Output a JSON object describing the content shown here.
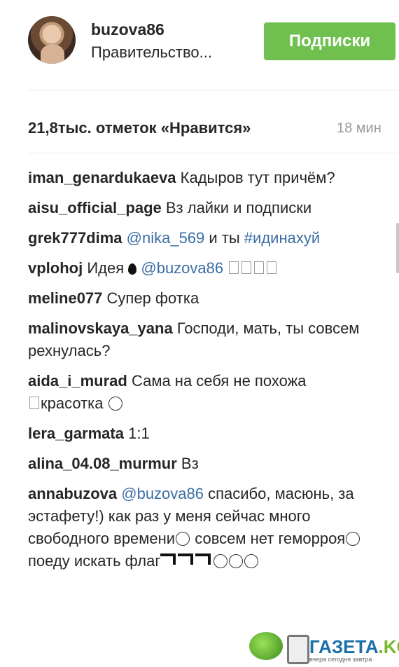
{
  "header": {
    "username": "buzova86",
    "subtitle": "Правительство...",
    "follow_button": "Подписки"
  },
  "post": {
    "likes": "21,8тыс. отметок «Нравится»",
    "time": "18 мин"
  },
  "comments": [
    {
      "user": "iman_genardukaeva",
      "text": " Кадыров тут причём?"
    },
    {
      "user": "aisu_official_page",
      "text": " Вз лайки и подписки"
    },
    {
      "user": "grek777dima",
      "mention": " @nika_569",
      "text": " и ты ",
      "hashtag": "#идинахуй"
    },
    {
      "user": "vplohoj",
      "text": " Идея ",
      "mention": "@buzova86"
    },
    {
      "user": "meline077",
      "text": " Супер фотка"
    },
    {
      "user": "malinovskaya_yana",
      "text": " Господи, мать, ты совсем рехнулась?"
    },
    {
      "user": "aida_i_murad",
      "text": " Сама на себя не похожа",
      "text2": "красотка"
    },
    {
      "user": "lera_garmata",
      "text": " 1:1"
    },
    {
      "user": "alina_04.08_murmur",
      "text": " Вз"
    },
    {
      "user": "annabuzova",
      "mention": " @buzova86",
      "text": " спасибо, масюнь, за эстафету!) как раз у меня сейчас много свободного времени",
      "text2": " совсем нет геморроя",
      "text3": " поеду искать флаг"
    }
  ],
  "watermark": {
    "brand": "ГАЗЕТА",
    "tld": ".KG",
    "tagline": "вчера сегодня завтра"
  }
}
